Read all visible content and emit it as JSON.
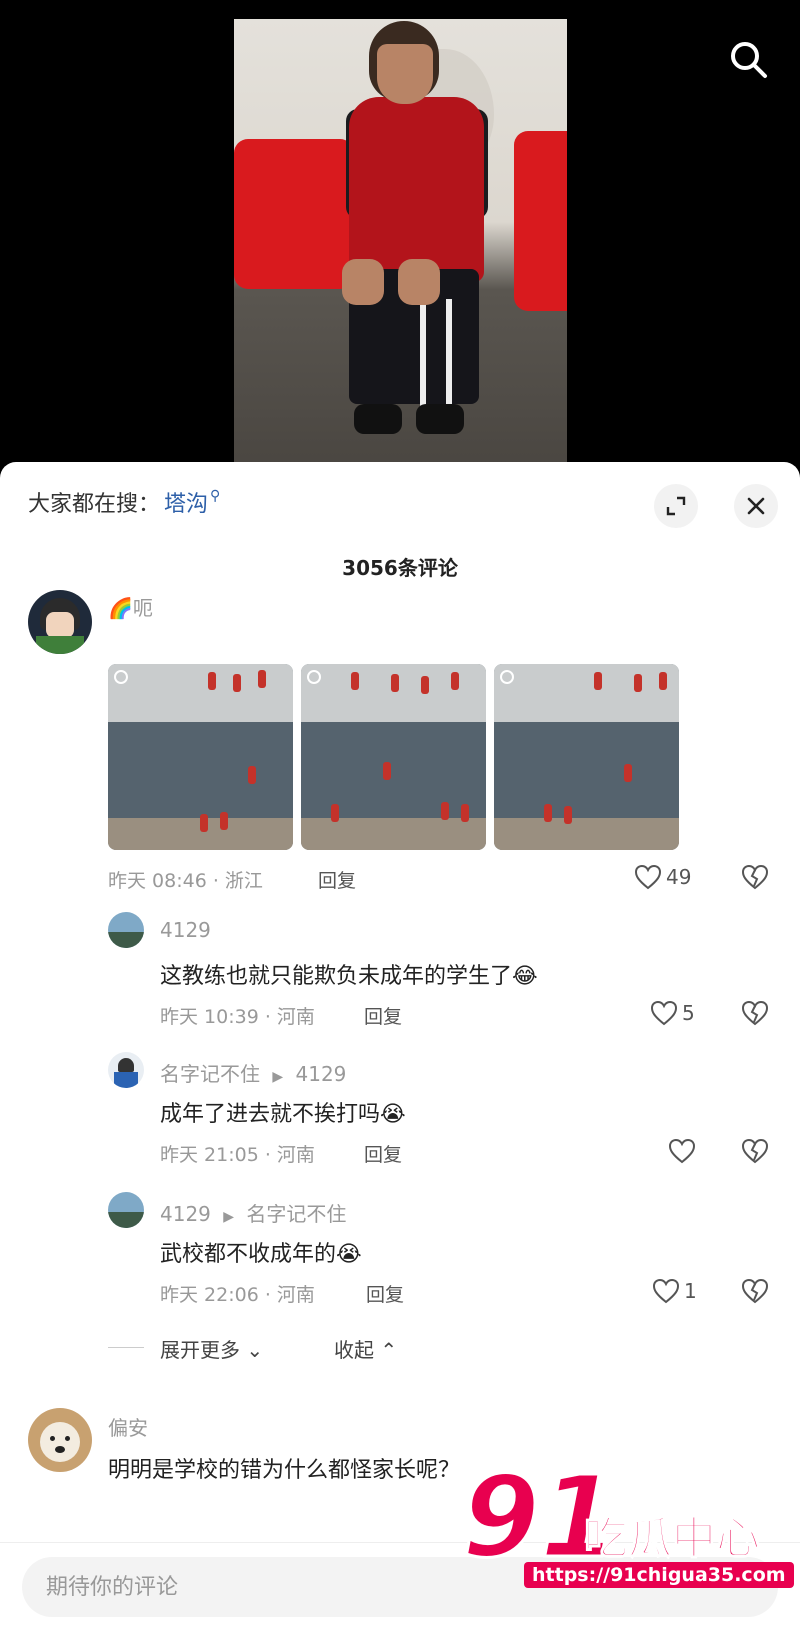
{
  "trending": {
    "prefix": "大家都在搜：",
    "term": "塔沟"
  },
  "comment_count": "3056条评论",
  "comments": [
    {
      "user": "🌈呃",
      "meta": "昨天 08:46 · 浙江",
      "reply_label": "回复",
      "likes": "49",
      "replies": [
        {
          "user": "4129",
          "text": "这教练也就只能欺负未成年的学生了😂",
          "meta": "昨天 10:39 · 河南",
          "reply_label": "回复",
          "likes": "5"
        },
        {
          "user": "名字记不住",
          "reply_to": "4129",
          "text": "成年了进去就不挨打吗😭",
          "meta": "昨天 21:05 · 河南",
          "reply_label": "回复",
          "likes": ""
        },
        {
          "user": "4129",
          "reply_to": "名字记不住",
          "text": "武校都不收成年的😭",
          "meta": "昨天 22:06 · 河南",
          "reply_label": "回复",
          "likes": "1"
        }
      ]
    },
    {
      "user": "偏安",
      "text": "明明是学校的错为什么都怪家长呢？"
    }
  ],
  "expand_more": "展开更多",
  "collapse": "收起",
  "input_placeholder": "期待你的评论",
  "watermark": {
    "number": "91",
    "name": "吃瓜中心",
    "url": "https://91chigua35.com"
  },
  "colors": {
    "accent_link": "#2d5fa8",
    "watermark": "#e8004f"
  }
}
